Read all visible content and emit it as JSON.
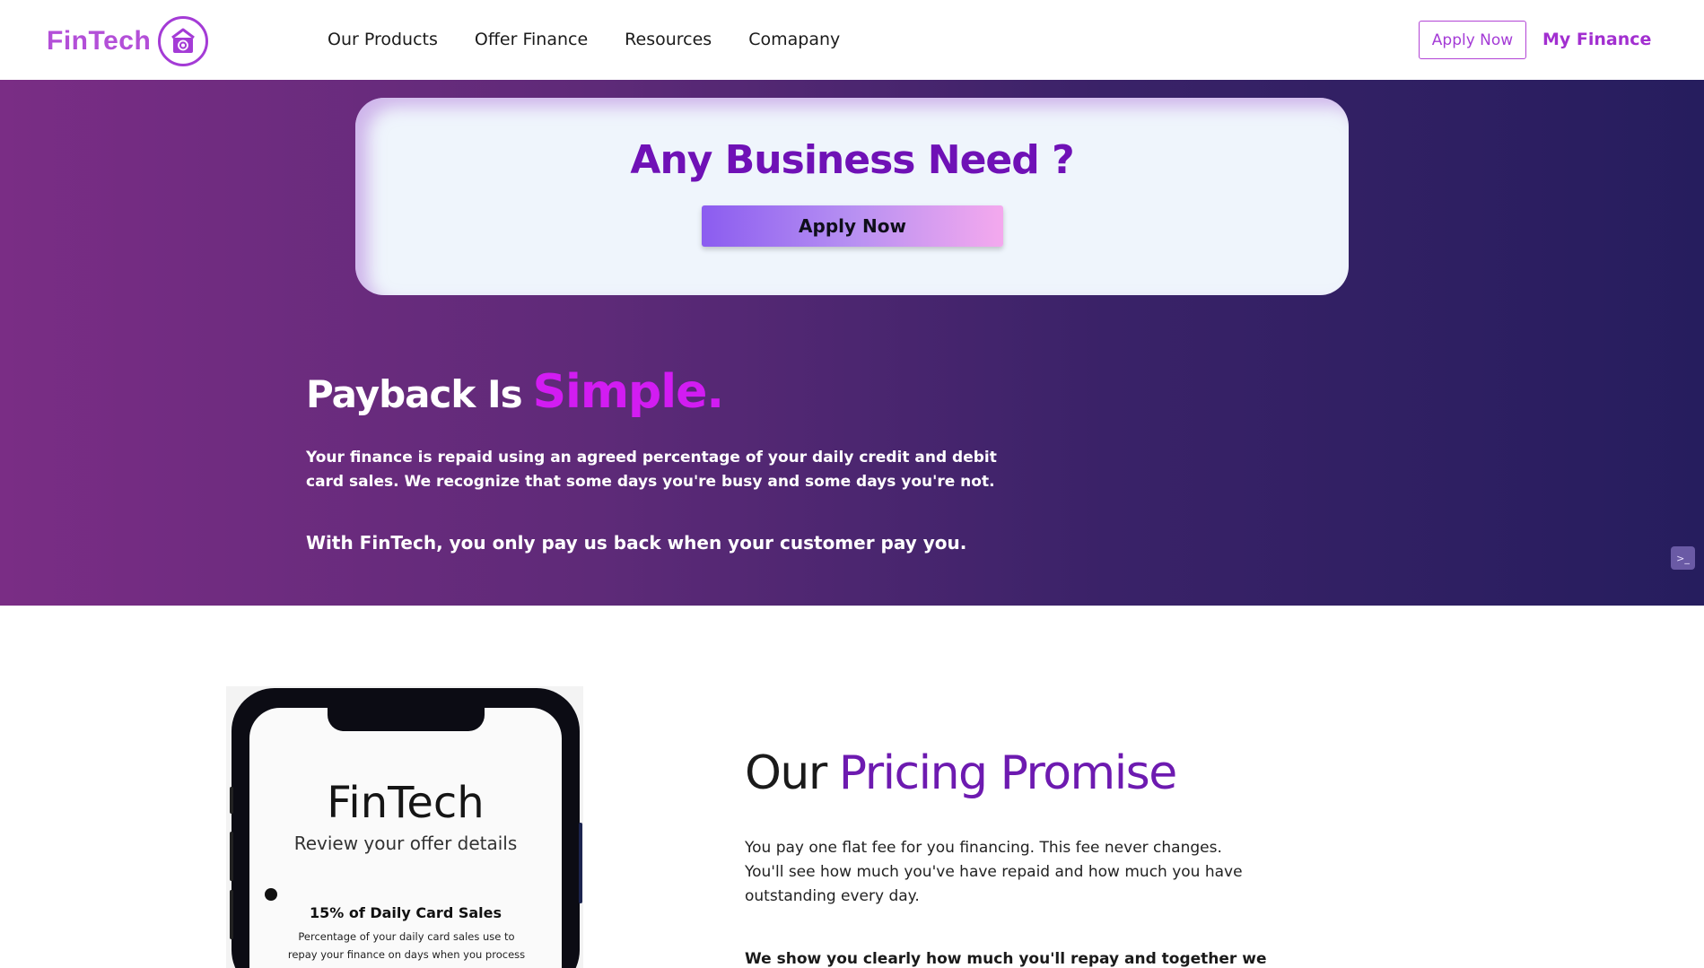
{
  "header": {
    "logo_text": "FinTech",
    "nav": [
      "Our Products",
      "Offer Finance",
      "Resources",
      "Comapany"
    ],
    "apply_label": "Apply Now",
    "my_finance_label": "My Finance"
  },
  "hero": {
    "card_title": "Any Business Need ?",
    "card_button": "Apply Now",
    "heading_part1": "Payback Is",
    "heading_part2": "Simple.",
    "paragraph": "Your finance is repaid using an agreed percentage of your daily credit and debit card sales. We recognize that some days you're busy and some days you're not.",
    "strong_line": "With FinTech, you only pay us back when your customer pay you."
  },
  "phone": {
    "brand": "FinTech",
    "subtitle": "Review your offer details",
    "offer_title": "15% of Daily Card Sales",
    "offer_desc": "Percentage of your daily card sales use to repay your finance on days when you process payments."
  },
  "pricing": {
    "heading_part1": "Our",
    "heading_part2": "Pricing Promise",
    "paragraph": "You pay one flat fee for you financing. This fee never changes. You'll see how much you've have repaid and how much you have outstanding every day.",
    "strong_line": "We show you clearly how much you'll repay and together we"
  },
  "colors": {
    "brand_purple": "#a43bd6",
    "accent_magenta": "#d21cf2",
    "heading_purple": "#6f11b6"
  },
  "icons": {
    "logo": "safe-vault-icon",
    "widget": "code-icon"
  }
}
